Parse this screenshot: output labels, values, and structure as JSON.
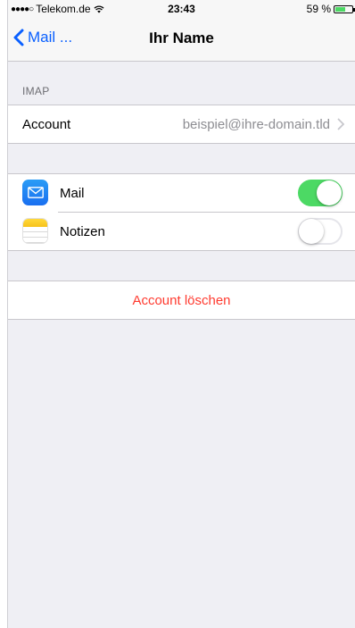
{
  "status": {
    "carrier": "Telekom.de",
    "signal_dots": "●●●●○",
    "time": "23:43",
    "battery": "59 %",
    "battery_level": 0.59
  },
  "nav": {
    "back_label": "Mail ...",
    "title": "Ihr Name"
  },
  "imap": {
    "header": "IMAP",
    "account_label": "Account",
    "account_value": "beispiel@ihre-domain.tld"
  },
  "apps": [
    {
      "label": "Mail",
      "enabled": true,
      "icon": "mail-icon"
    },
    {
      "label": "Notizen",
      "enabled": false,
      "icon": "notes-icon"
    }
  ],
  "delete": {
    "label": "Account löschen"
  },
  "colors": {
    "accent": "#0a60ff",
    "toggle_on": "#4cd964",
    "destructive": "#ff3b30"
  }
}
